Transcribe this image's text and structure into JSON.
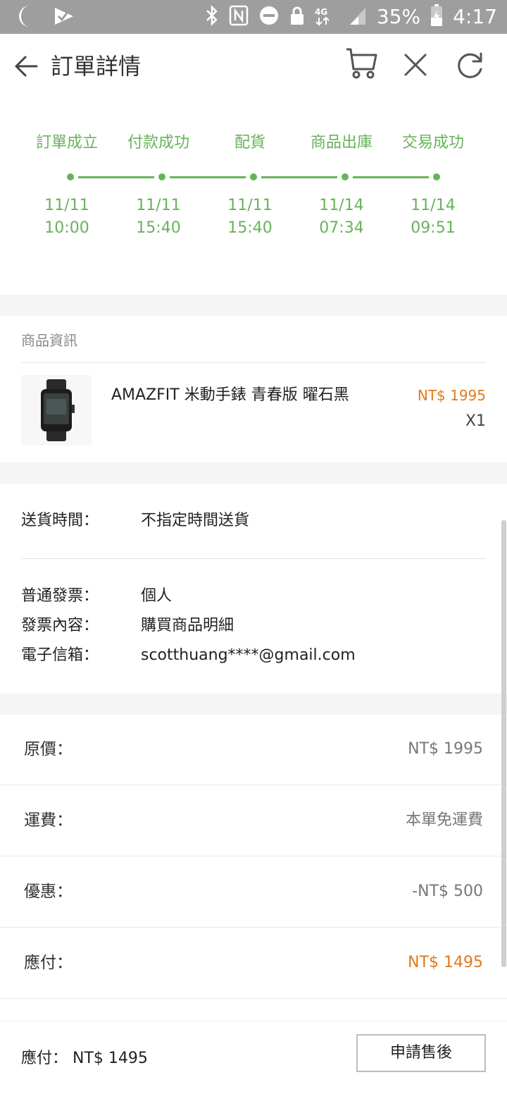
{
  "status_bar": {
    "battery": "35%",
    "time": "4:17"
  },
  "header": {
    "title": "訂單詳情"
  },
  "progress": {
    "color": "#67b35a",
    "steps": [
      {
        "label": "訂單成立",
        "date": "11/11",
        "time": "10:00"
      },
      {
        "label": "付款成功",
        "date": "11/11",
        "time": "15:40"
      },
      {
        "label": "配貨",
        "date": "11/11",
        "time": "15:40"
      },
      {
        "label": "商品出庫",
        "date": "11/14",
        "time": "07:34"
      },
      {
        "label": "交易成功",
        "date": "11/14",
        "time": "09:51"
      }
    ]
  },
  "product": {
    "section_title": "商品資訊",
    "name": "AMAZFIT 米動手錶 青春版 曜石黑",
    "price": "NT$ 1995",
    "quantity": "X1"
  },
  "info": {
    "delivery_label": "送貨時間：",
    "delivery_value": "不指定時間送貨",
    "invoice_label": "普通發票：",
    "invoice_value": "個人",
    "content_label": "發票內容：",
    "content_value": "購買商品明細",
    "email_label": "電子信箱：",
    "email_value": "scotthuang****@gmail.com"
  },
  "summary": {
    "original_label": "原價：",
    "original_value": "NT$ 1995",
    "shipping_label": "運費：",
    "shipping_value": "本單免運費",
    "discount_label": "優惠：",
    "discount_value": "-NT$ 500",
    "payable_label": "應付：",
    "payable_value": "NT$ 1495"
  },
  "bottom": {
    "total_text": "應付： NT$ 1495",
    "after_sales_button": "申請售後"
  },
  "colors": {
    "accent_green": "#67b35a",
    "price_orange": "#e07a1e"
  }
}
